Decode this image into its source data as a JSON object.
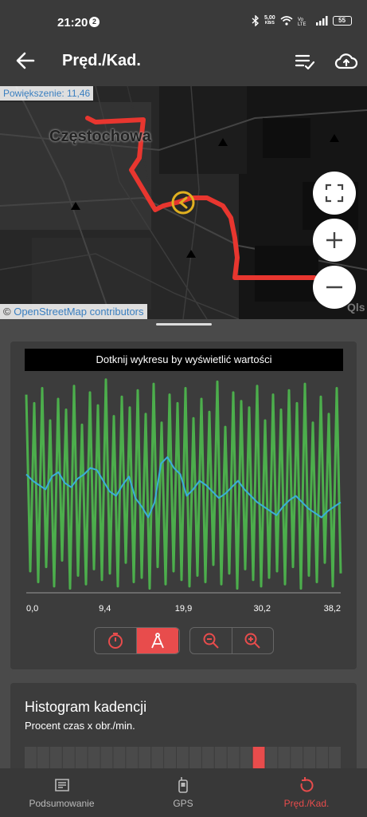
{
  "status": {
    "time": "21:20",
    "notification_count": "2",
    "net_speed": "5,00",
    "net_unit": "KB/S",
    "battery": "55"
  },
  "app_bar": {
    "title": "Pręd./Kad."
  },
  "map": {
    "zoom_label": "Powiększenie: 11,46",
    "city": "Częstochowa",
    "credit_prefix": "© ",
    "credit_link": "OpenStreetMap contributors"
  },
  "chart": {
    "hint": "Dotknij wykresu by wyświetlić wartości",
    "colors": {
      "cadence": "#4cae4c",
      "speed": "#3aaed8"
    },
    "chart_data": {
      "type": "line",
      "xlabel": "",
      "ylabel": "",
      "x_ticks": [
        "0,0",
        "9,4",
        "19,9",
        "30,2",
        "38,2"
      ],
      "xlim": [
        0,
        38.2
      ],
      "ylim": [
        0,
        100
      ],
      "series": [
        {
          "values": [
            92,
            10,
            88,
            5,
            95,
            12,
            80,
            3,
            90,
            15,
            85,
            2,
            96,
            8,
            78,
            4,
            93,
            11,
            87,
            6,
            99,
            9,
            82,
            3,
            91,
            14,
            86,
            5,
            94,
            7,
            83,
            2,
            97,
            12,
            79,
            4,
            92,
            10,
            88,
            6,
            95,
            3,
            81,
            8,
            90,
            5,
            84,
            13,
            98,
            4,
            77,
            9,
            93,
            2,
            89,
            11,
            86,
            6,
            96,
            3,
            80,
            7,
            92,
            10,
            85,
            4,
            94,
            12,
            88,
            2,
            97,
            8,
            79,
            5,
            91,
            14,
            83,
            3,
            95,
            9
          ]
        },
        {
          "values": [
            55,
            52,
            50,
            48,
            54,
            56,
            51,
            49,
            53,
            55,
            58,
            57,
            52,
            47,
            45,
            50,
            54,
            44,
            40,
            35,
            42,
            60,
            63,
            58,
            55,
            45,
            48,
            52,
            50,
            47,
            44,
            46,
            49,
            52,
            48,
            45,
            42,
            40,
            38,
            36,
            40,
            43,
            45,
            42,
            39,
            37,
            35,
            38,
            40,
            42
          ]
        }
      ]
    }
  },
  "controls": {
    "timer_icon": "stopwatch-icon",
    "distance_icon": "compass-icon",
    "zoom_out_icon": "zoom-out-icon",
    "zoom_in_icon": "zoom-in-icon"
  },
  "histogram": {
    "title": "Histogram kadencji",
    "subtitle": "Procent czas x obr./min.",
    "highlight_color": "#e84c4c"
  },
  "bottom_nav": {
    "items": [
      {
        "label": "Podsumowanie",
        "icon": "document-icon"
      },
      {
        "label": "GPS",
        "icon": "gps-device-icon"
      },
      {
        "label": "Pręd./Kad.",
        "icon": "refresh-icon"
      }
    ]
  }
}
